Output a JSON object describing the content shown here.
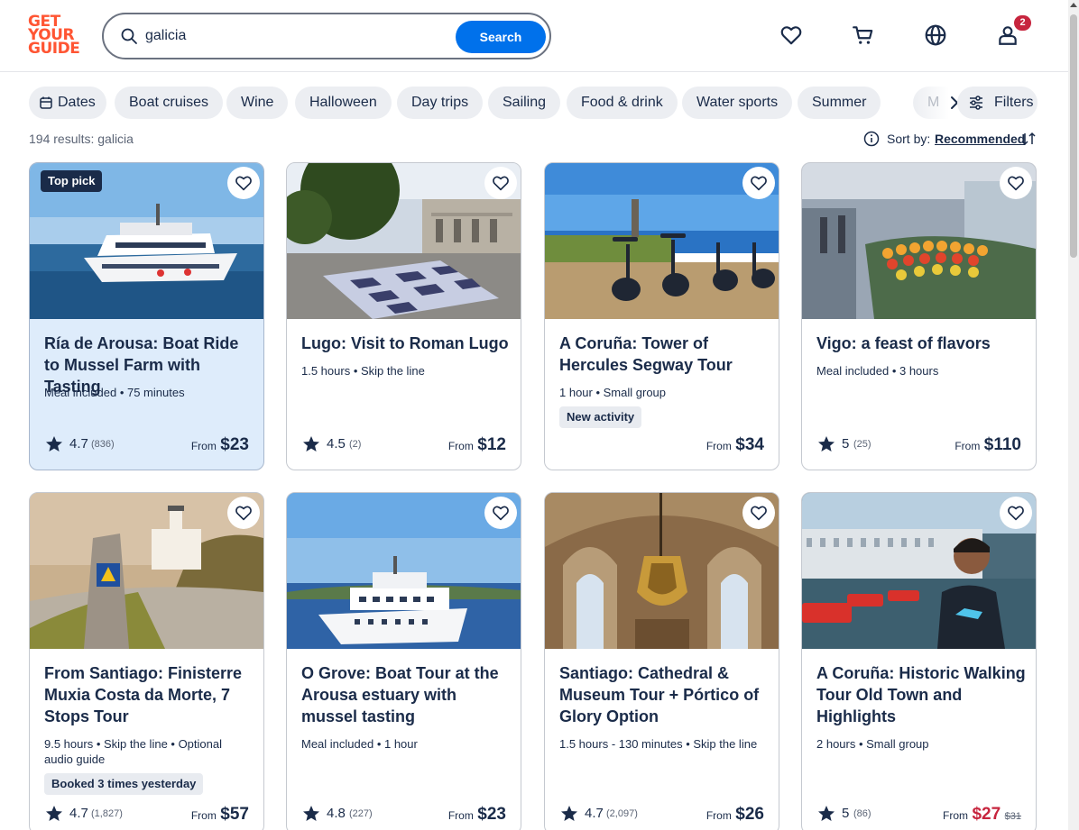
{
  "header": {
    "logo_lines": [
      "GET",
      "YOUR",
      "GUIDE"
    ],
    "search_value": "galicia",
    "search_button": "Search",
    "cart_badge": "2",
    "icons": [
      "wishlist-heart-icon",
      "cart-icon",
      "globe-icon",
      "profile-icon"
    ]
  },
  "chips": [
    "Dates",
    "Boat cruises",
    "Wine",
    "Halloween",
    "Day trips",
    "Sailing",
    "Food & drink",
    "Water sports",
    "Summer",
    "M"
  ],
  "filters_label": "Filters",
  "results_text": "194 results: galicia",
  "sort": {
    "label": "Sort by:",
    "value": "Recommended"
  },
  "colors": {
    "brand": "#ff5533",
    "primary": "#0071eb",
    "navy": "#1a2b49",
    "sale": "#c7253e",
    "highlight": "#deecfb"
  },
  "cards": [
    {
      "tag": "Top pick",
      "title": "Ría de Arousa: Boat Ride to Mussel Farm with Tasting",
      "meta": "Meal included • 75 minutes",
      "rating": "4.7",
      "reviews": "(836)",
      "from": "From",
      "price": "$23"
    },
    {
      "title": "Lugo: Visit to Roman Lugo",
      "meta": "1.5 hours • Skip the line",
      "rating": "4.5",
      "reviews": "(2)",
      "from": "From",
      "price": "$12"
    },
    {
      "title": "A Coruña: Tower of Hercules Segway Tour",
      "meta": "1 hour • Small group",
      "pill": "New activity",
      "from": "From",
      "price": "$34"
    },
    {
      "title": "Vigo: a feast of flavors",
      "meta": "Meal included • 3 hours",
      "rating": "5",
      "reviews": "(25)",
      "from": "From",
      "price": "$110"
    },
    {
      "title": "From Santiago: Finisterre Muxia Costa da Morte, 7 Stops Tour",
      "meta": "9.5 hours • Skip the line • Optional audio guide",
      "pill": "Booked 3 times yesterday",
      "rating": "4.7",
      "reviews": "(1,827)",
      "from": "From",
      "price": "$57"
    },
    {
      "title": "O Grove: Boat Tour at the Arousa estuary with mussel tasting",
      "meta": "Meal included • 1 hour",
      "rating": "4.8",
      "reviews": "(227)",
      "from": "From",
      "price": "$23"
    },
    {
      "title": "Santiago: Cathedral & Museum Tour + Pórtico of Glory Option",
      "meta": "1.5 hours - 130 minutes • Skip the line",
      "rating": "4.7",
      "reviews": "(2,097)",
      "from": "From",
      "price": "$26"
    },
    {
      "title": "A Coruña: Historic Walking Tour Old Town and Highlights",
      "meta": "2 hours • Small group",
      "rating": "5",
      "reviews": "(86)",
      "from": "From",
      "price": "$27",
      "old_price": "$31"
    }
  ]
}
